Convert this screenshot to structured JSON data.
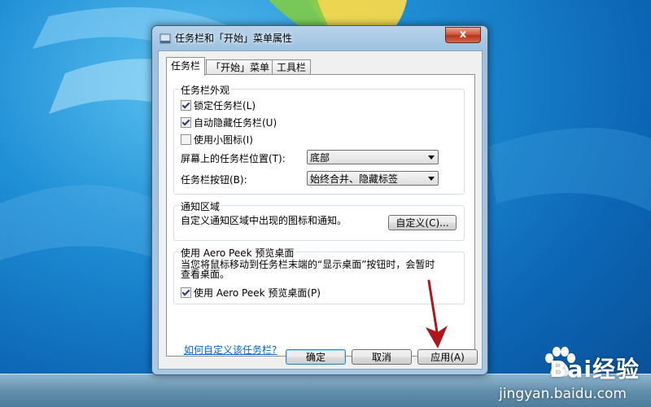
{
  "dialog": {
    "title": "任务栏和「开始」菜单属性",
    "close_label": "x"
  },
  "tabs": [
    {
      "label": "任务栏",
      "active": true
    },
    {
      "label": "「开始」菜单",
      "active": false
    },
    {
      "label": "工具栏",
      "active": false
    }
  ],
  "appearance": {
    "title": "任务栏外观",
    "lock": {
      "label": "锁定任务栏(L)",
      "checked": true
    },
    "autohide": {
      "label": "自动隐藏任务栏(U)",
      "checked": true
    },
    "small_icons": {
      "label": "使用小图标(I)",
      "checked": false
    },
    "location_label": "屏幕上的任务栏位置(T):",
    "location_value": "底部",
    "buttons_label": "任务栏按钮(B):",
    "buttons_value": "始终合并、隐藏标签"
  },
  "notification": {
    "title": "通知区域",
    "desc": "自定义通知区域中出现的图标和通知。",
    "customize_button": "自定义(C)..."
  },
  "aero_peek": {
    "title": "使用 Aero Peek 预览桌面",
    "desc_line1": "当您将鼠标移动到任务栏末端的“显示桌面”按钮时，会暂时",
    "desc_line2": "查看桌面。",
    "checkbox": {
      "label": "使用 Aero Peek 预览桌面(P)",
      "checked": true
    }
  },
  "help_link": "如何自定义该任务栏?",
  "footer": {
    "ok": "确定",
    "cancel": "取消",
    "apply": "应用(A)"
  },
  "watermark": {
    "logo": "Bai经验",
    "url": "jingyan.baidu.com"
  },
  "colors": {
    "annotation_arrow": "#b0151b",
    "link": "#0066cc"
  }
}
